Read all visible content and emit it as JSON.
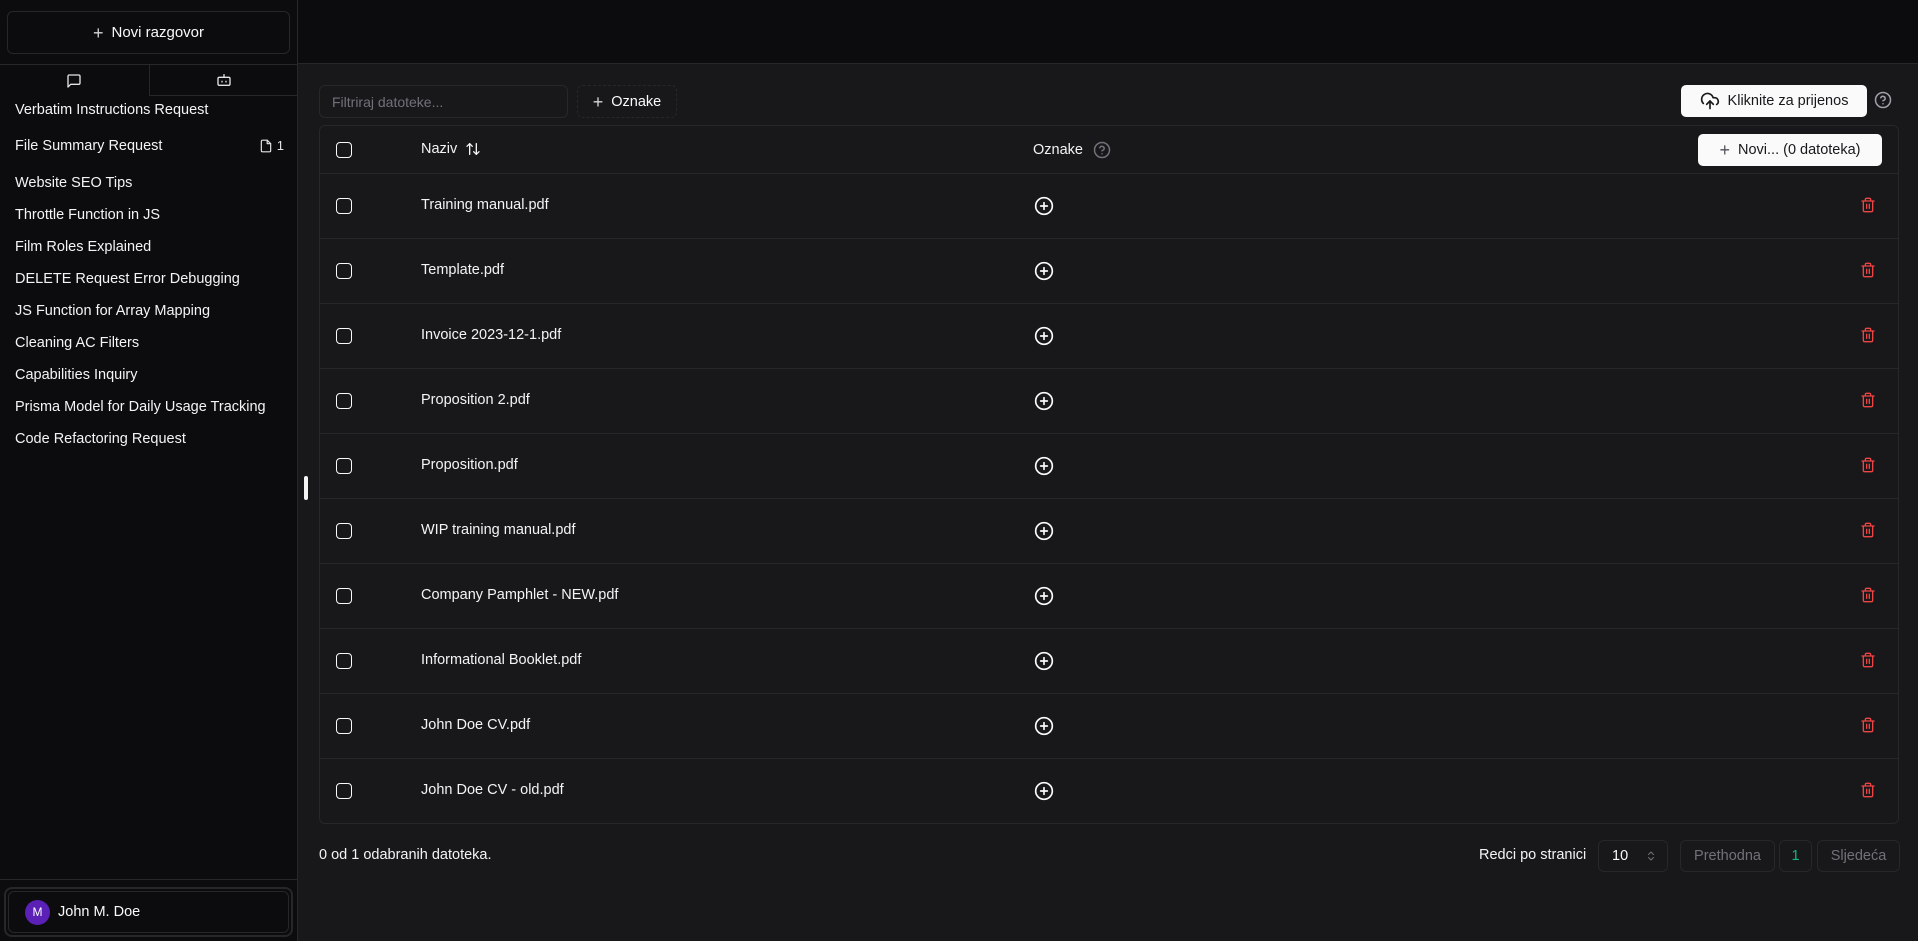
{
  "sidebar": {
    "new_chat_label": "Novi razgovor",
    "tabs": [
      {
        "icon": "message-square-icon",
        "active": true
      },
      {
        "icon": "bot-icon",
        "active": false
      }
    ],
    "chats": [
      {
        "title": "Verbatim Instructions Request"
      },
      {
        "title": "File Summary Request",
        "file_count": "1"
      },
      {
        "title": "Website SEO Tips"
      },
      {
        "title": "Throttle Function in JS"
      },
      {
        "title": "Film Roles Explained"
      },
      {
        "title": "DELETE Request Error Debugging"
      },
      {
        "title": "JS Function for Array Mapping"
      },
      {
        "title": "Cleaning AC Filters"
      },
      {
        "title": "Capabilities Inquiry"
      },
      {
        "title": "Prisma Model for Daily Usage Tracking"
      },
      {
        "title": "Code Refactoring Request"
      }
    ],
    "user": {
      "initial": "M",
      "name": "John M. Doe",
      "avatar_color": "#5b21b6"
    }
  },
  "toolbar": {
    "filter_placeholder": "Filtriraj datoteke...",
    "filter_value": "",
    "tags_label": "Oznake",
    "upload_label": "Kliknite za prijenos"
  },
  "table": {
    "headers": {
      "name": "Naziv",
      "tags": "Oznake",
      "new_button": "Novi... (0 datoteka)"
    },
    "rows": [
      {
        "name": "Training manual.pdf"
      },
      {
        "name": "Template.pdf"
      },
      {
        "name": "Invoice 2023-12-1.pdf"
      },
      {
        "name": "Proposition 2.pdf"
      },
      {
        "name": "Proposition.pdf"
      },
      {
        "name": "WIP training manual.pdf"
      },
      {
        "name": "Company Pamphlet - NEW.pdf"
      },
      {
        "name": "Informational Booklet.pdf"
      },
      {
        "name": "John Doe CV.pdf"
      },
      {
        "name": "John Doe CV - old.pdf"
      }
    ]
  },
  "footer": {
    "selected_text": "0 od 1 odabranih datoteka.",
    "rows_per_page_label": "Redci po stranici",
    "rows_per_page_value": "10",
    "prev_label": "Prethodna",
    "current_page": "1",
    "next_label": "Sljedeća"
  },
  "colors": {
    "accent_page": "#10b981",
    "danger": "#ef4444",
    "background": "#18181b",
    "sidebar_bg": "#0c0c0e"
  }
}
